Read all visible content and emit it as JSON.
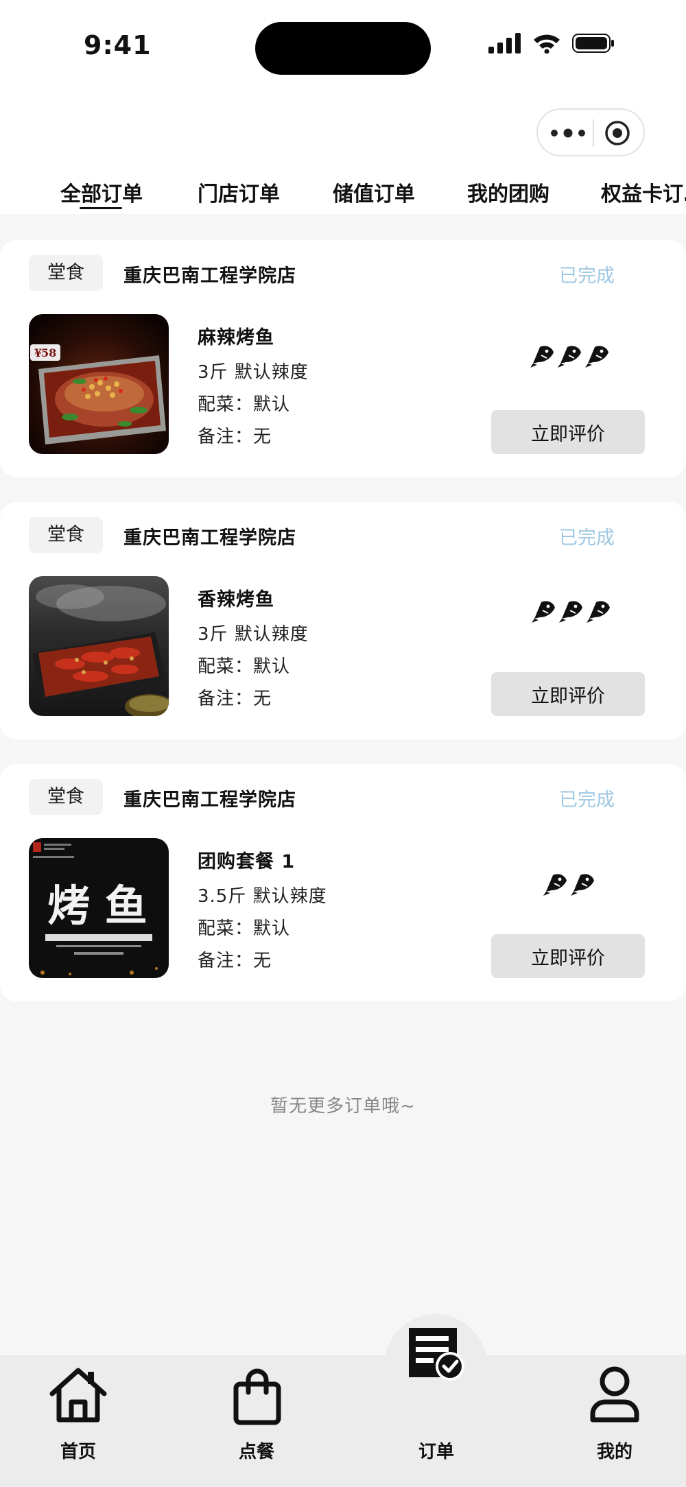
{
  "status_bar": {
    "time": "9:41"
  },
  "tabs": [
    "全部订单",
    "门店订单",
    "储值订单",
    "我的团购",
    "权益卡订…"
  ],
  "orders": [
    {
      "type": "堂食",
      "store": "重庆巴南工程学院店",
      "status": "已完成",
      "dish": "麻辣烤鱼",
      "spec": "3斤  默认辣度",
      "sides": "配菜：默认",
      "note": "备注：无",
      "spice_icons": 3,
      "action": "立即评价",
      "thumb_price": "58"
    },
    {
      "type": "堂食",
      "store": "重庆巴南工程学院店",
      "status": "已完成",
      "dish": "香辣烤鱼",
      "spec": "3斤  默认辣度",
      "sides": "配菜：默认",
      "note": "备注：无",
      "spice_icons": 3,
      "action": "立即评价"
    },
    {
      "type": "堂食",
      "store": "重庆巴南工程学院店",
      "status": "已完成",
      "dish": "团购套餐 1",
      "spec": "3.5斤  默认辣度",
      "sides": "配菜：默认",
      "note": "备注：无",
      "spice_icons": 2,
      "action": "立即评价",
      "thumb_text": "烤 鱼"
    }
  ],
  "footer_text": "暂无更多订单哦~",
  "nav": [
    {
      "label": "首页",
      "icon": "home-icon"
    },
    {
      "label": "点餐",
      "icon": "shopping-bag-icon"
    },
    {
      "label": "订单",
      "icon": "order-receipt-icon"
    },
    {
      "label": "我的",
      "icon": "user-icon"
    }
  ],
  "colors": {
    "status": "#9dc7e3",
    "navbar": "#ececec",
    "background": "#f6f6f6"
  }
}
